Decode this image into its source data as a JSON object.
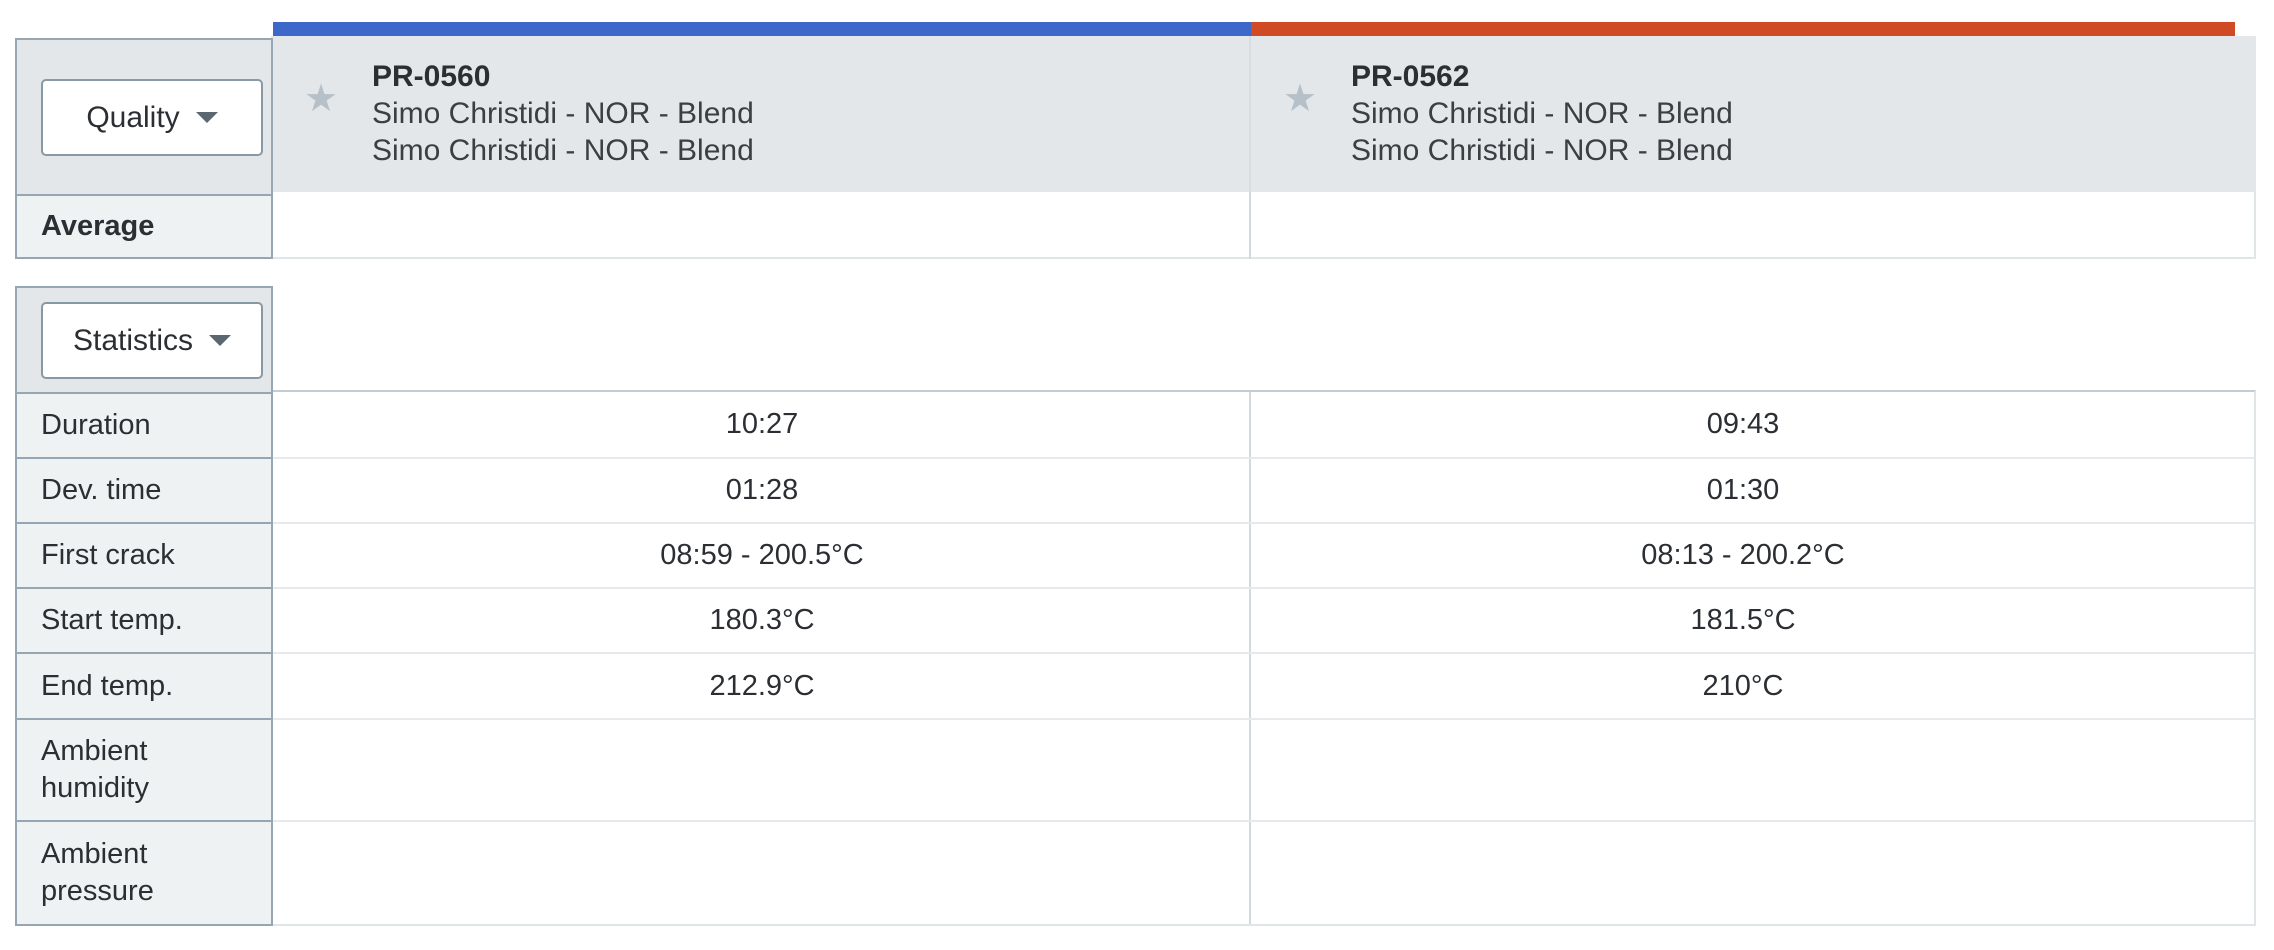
{
  "quality_dropdown": {
    "label": "Quality"
  },
  "statistics_dropdown": {
    "label": "Statistics"
  },
  "average_label": "Average",
  "profiles": [
    {
      "id": "PR-0560",
      "line1": "Simo Christidi - NOR - Blend",
      "line2": "Simo Christidi - NOR - Blend",
      "color": "#3d67c9",
      "icon": "star-icon",
      "stats": {
        "duration": "10:27",
        "dev_time": "01:28",
        "first_crack": "08:59 - 200.5°C",
        "start_temp": "180.3°C",
        "end_temp": "212.9°C"
      }
    },
    {
      "id": "PR-0562",
      "line1": "Simo Christidi - NOR - Blend",
      "line2": "Simo Christidi - NOR - Blend",
      "color": "#d04a26",
      "icon": "star-icon",
      "stats": {
        "duration": "09:43",
        "dev_time": "01:30",
        "first_crack": "08:13 - 200.2°C",
        "start_temp": "181.5°C",
        "end_temp": "210°C"
      }
    }
  ],
  "stat_labels": {
    "duration": "Duration",
    "dev_time": "Dev. time",
    "first_crack": "First crack",
    "start_temp": "Start temp.",
    "end_temp": "End temp.",
    "ambient_humidity": "Ambient humidity",
    "ambient_pressure": "Ambient pressure"
  }
}
